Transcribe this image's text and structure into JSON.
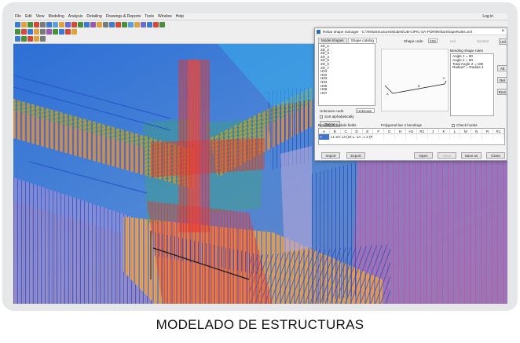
{
  "caption": "MODELADO DE ESTRUCTURAS",
  "app": {
    "menu": [
      "File",
      "Edit",
      "View",
      "Modeling",
      "Analysis",
      "Detailing",
      "Drawings & Reports",
      "Tools",
      "Window",
      "Help"
    ],
    "user": "Log in"
  },
  "dialog": {
    "title": "Rebar shape manager - C:\\TeklaStructuresModels\\UB-CIPIC-SA-POR\\RebarShapeRules.xml",
    "tabs": [
      "Model shapes",
      "Shape catalog"
    ],
    "active_tab": "Shape catalog",
    "shape_list": [
      "2D_1",
      "2D_2",
      "2D_3",
      "2D_4",
      "2D_5",
      "2D_6",
      "2D_7",
      "H01",
      "H02",
      "H03",
      "H04",
      "H05",
      "H06",
      "H07"
    ],
    "shape_code_label": "Shape code",
    "shape_code_value": "3S5",
    "top_labels": [
      "Hel",
      "Symbol",
      "Hel"
    ],
    "unknown_code_label": "Unknown code",
    "unknown_code_value": "Unknown",
    "sort_label": "Sort alphabetically",
    "delete_label": "Delete",
    "bending_rules_label": "Bending shape rules",
    "bending_rules": [
      "Angle 1 = 90",
      "Angle 2 = 90",
      "Total Angle 2 = 180",
      "Radius* = Radius 1"
    ],
    "right_buttons": [
      "Alt",
      "Rel",
      "Rem"
    ],
    "preview_labels": [
      "A",
      "B",
      "C"
    ],
    "fields_label": "Bending schedule fields",
    "polygonal_label": "Polygonal bar 2 bendings",
    "check_hooks_label": "Check hooks",
    "table_headers": [
      "A",
      "B",
      "C",
      "D",
      "E",
      "F",
      "G",
      "H",
      "H1",
      "R1",
      "J",
      "K",
      "L",
      "M",
      "N",
      "R",
      "R1"
    ],
    "table_row": [
      "A",
      "L1-2A",
      "L3 (SN)",
      "L, 1A",
      "L 2 (P)",
      "",
      "",
      "",
      "",
      "",
      "",
      "",
      "",
      "",
      "",
      "",
      ""
    ],
    "bottom_buttons": [
      "Import",
      "Export",
      "Open",
      "Save",
      "Save as",
      "Close"
    ]
  },
  "colors": {
    "steel_blue": "#2a56c8",
    "rebar_red": "#e8342a",
    "rebar_orange": "#f08a24",
    "rebar_green": "#3fbf3f",
    "background_blue": "#4d79b8"
  }
}
